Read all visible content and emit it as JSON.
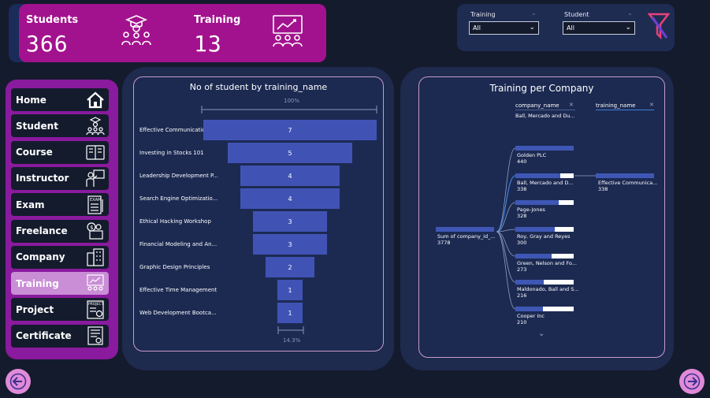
{
  "kpi": {
    "students_label": "Students",
    "students_value": "366",
    "training_label": "Training",
    "training_value": "13"
  },
  "filters": {
    "training_label": "Training",
    "training_value": "All",
    "student_label": "Student",
    "student_value": "All"
  },
  "nav": {
    "items": [
      {
        "label": "Home",
        "icon": "home-icon"
      },
      {
        "label": "Student",
        "icon": "student-icon"
      },
      {
        "label": "Course",
        "icon": "course-icon"
      },
      {
        "label": "Instructor",
        "icon": "instructor-icon"
      },
      {
        "label": "Exam",
        "icon": "exam-icon"
      },
      {
        "label": "Freelance",
        "icon": "freelance-icon"
      },
      {
        "label": "Company",
        "icon": "company-icon"
      },
      {
        "label": "Training",
        "icon": "training-icon"
      },
      {
        "label": "Project",
        "icon": "project-icon"
      },
      {
        "label": "Certificate",
        "icon": "certificate-icon"
      }
    ],
    "active": "Training"
  },
  "funnel": {
    "title": "No of student by training_name",
    "top_pct": "100%",
    "bottom_pct": "14.3%",
    "colors": {
      "bar": "#4053b5"
    }
  },
  "tree": {
    "title": "Training per Company",
    "col1_header": "company_name",
    "col1_filter": "Ball, Mercado and Du...",
    "col2_header": "training_name",
    "root_label": "Sum of company_id_...",
    "root_value": "3778",
    "nodes": [
      {
        "label": "Golden PLC",
        "value": "440"
      },
      {
        "label": "Ball, Mercado and D...",
        "value": "338"
      },
      {
        "label": "Page-Jones",
        "value": "328"
      },
      {
        "label": "Roy, Gray and Reyes",
        "value": "300"
      },
      {
        "label": "Green, Nelson and Fo...",
        "value": "273"
      },
      {
        "label": "Maldonado, Ball and S...",
        "value": "216"
      },
      {
        "label": "Cooper Inc",
        "value": "210"
      }
    ],
    "leaf_label": "Effective Communica...",
    "leaf_value": "338"
  },
  "chart_data": {
    "type": "bar",
    "title": "No of student by training_name",
    "categories": [
      "Effective Communication S...",
      "Investing in Stocks 101",
      "Leadership Development P...",
      "Search Engine Optimizatio...",
      "Ethical Hacking Workshop",
      "Financial Modeling and An...",
      "Graphic Design Principles",
      "Effective Time Management",
      "Web Development Bootca..."
    ],
    "values": [
      7,
      5,
      4,
      4,
      3,
      3,
      2,
      1,
      1
    ],
    "value_labels": [
      "7",
      "5",
      "4",
      "4",
      "3",
      "3",
      "2",
      "1",
      "1"
    ],
    "orientation": "funnel"
  }
}
